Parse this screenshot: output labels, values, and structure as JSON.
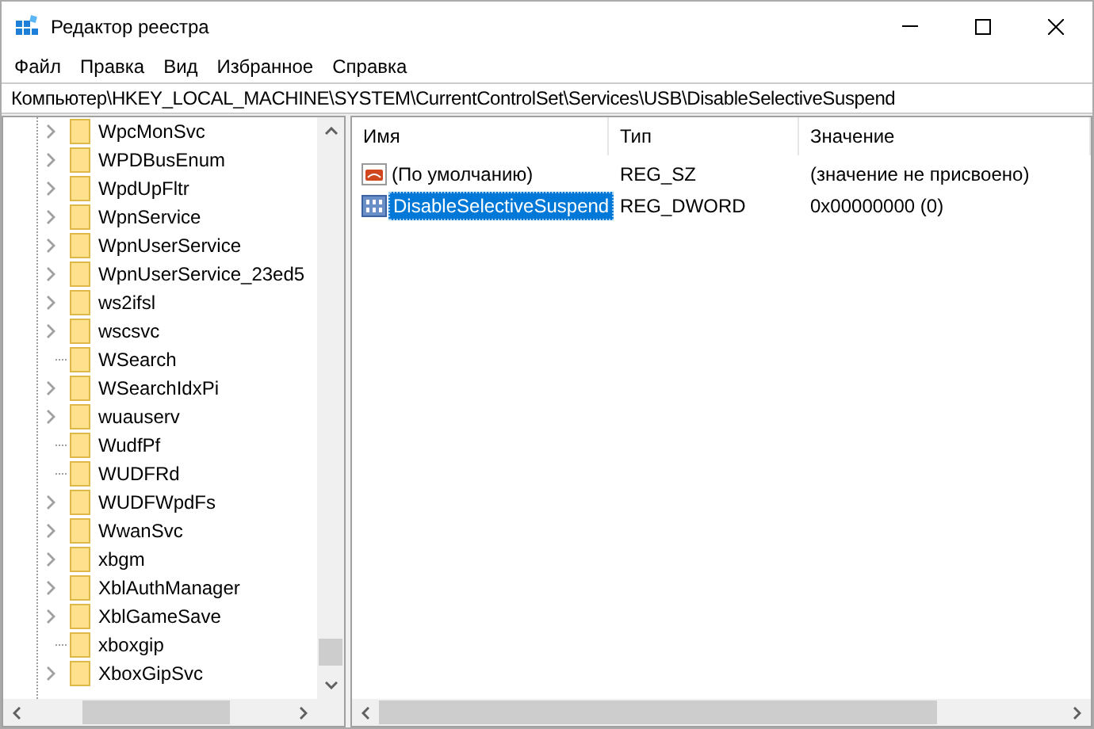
{
  "window": {
    "title": "Редактор реестра"
  },
  "menu": [
    "Файл",
    "Правка",
    "Вид",
    "Избранное",
    "Справка"
  ],
  "address": "Компьютер\\HKEY_LOCAL_MACHINE\\SYSTEM\\CurrentControlSet\\Services\\USB\\DisableSelectiveSuspend",
  "tree": [
    {
      "label": "WpcMonSvc",
      "has_children": true
    },
    {
      "label": "WPDBusEnum",
      "has_children": true
    },
    {
      "label": "WpdUpFltr",
      "has_children": true
    },
    {
      "label": "WpnService",
      "has_children": true
    },
    {
      "label": "WpnUserService",
      "has_children": true
    },
    {
      "label": "WpnUserService_23ed5",
      "has_children": true
    },
    {
      "label": "ws2ifsl",
      "has_children": true
    },
    {
      "label": "wscsvc",
      "has_children": true
    },
    {
      "label": "WSearch",
      "has_children": false
    },
    {
      "label": "WSearchIdxPi",
      "has_children": true
    },
    {
      "label": "wuauserv",
      "has_children": true
    },
    {
      "label": "WudfPf",
      "has_children": false
    },
    {
      "label": "WUDFRd",
      "has_children": false
    },
    {
      "label": "WUDFWpdFs",
      "has_children": true
    },
    {
      "label": "WwanSvc",
      "has_children": true
    },
    {
      "label": "xbgm",
      "has_children": true
    },
    {
      "label": "XblAuthManager",
      "has_children": true
    },
    {
      "label": "XblGameSave",
      "has_children": true
    },
    {
      "label": "xboxgip",
      "has_children": false
    },
    {
      "label": "XboxGipSvc",
      "has_children": true
    }
  ],
  "table": {
    "columns": [
      "Имя",
      "Тип",
      "Значение"
    ],
    "rows": [
      {
        "kind": "string",
        "name": "(По умолчанию)",
        "type": "REG_SZ",
        "value": "(значение не присвоено)",
        "selected": false
      },
      {
        "kind": "binary",
        "name": "DisableSelectiveSuspend",
        "type": "REG_DWORD",
        "value": "0x00000000 (0)",
        "selected": true
      }
    ]
  }
}
